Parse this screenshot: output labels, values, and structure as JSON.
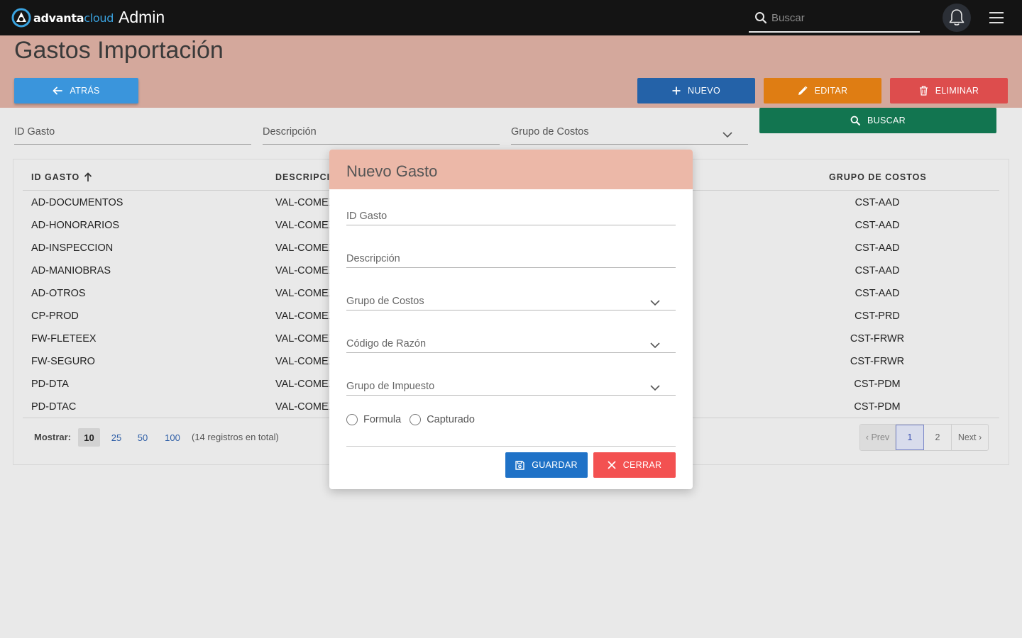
{
  "app": {
    "brand_part1": "advanta",
    "brand_part2": "cloud",
    "title": "Admin",
    "search_placeholder": "Buscar"
  },
  "page": {
    "title": "Gastos Importación",
    "back_label": "ATRÁS",
    "new_label": "NUEVO",
    "edit_label": "EDITAR",
    "delete_label": "ELIMINAR",
    "search_label": "BUSCAR"
  },
  "filters": {
    "id": "ID Gasto",
    "description": "Descripción",
    "cost_group": "Grupo de Costos"
  },
  "table": {
    "headers": [
      "ID GASTO",
      "DESCRIPCI",
      "GRUPO DE COSTOS"
    ],
    "rows": [
      {
        "id": "AD-DOCUMENTOS",
        "desc": "VAL-COMEX",
        "group": "CST-AAD"
      },
      {
        "id": "AD-HONORARIOS",
        "desc": "VAL-COMEX",
        "group": "CST-AAD"
      },
      {
        "id": "AD-INSPECCION",
        "desc": "VAL-COMEX",
        "group": "CST-AAD"
      },
      {
        "id": "AD-MANIOBRAS",
        "desc": "VAL-COMEX",
        "group": "CST-AAD"
      },
      {
        "id": "AD-OTROS",
        "desc": "VAL-COMEX",
        "group": "CST-AAD"
      },
      {
        "id": "CP-PROD",
        "desc": "VAL-COMEX",
        "group": "CST-PRD"
      },
      {
        "id": "FW-FLETEEX",
        "desc": "VAL-COMEX",
        "group": "CST-FRWR"
      },
      {
        "id": "FW-SEGURO",
        "desc": "VAL-COMEX",
        "group": "CST-FRWR"
      },
      {
        "id": "PD-DTA",
        "desc": "VAL-COMEX",
        "group": "CST-PDM"
      },
      {
        "id": "PD-DTAC",
        "desc": "VAL-COMEX",
        "group": "CST-PDM"
      }
    ]
  },
  "pagination": {
    "show_label": "Mostrar:",
    "sizes": [
      "10",
      "25",
      "50",
      "100"
    ],
    "total_text": "(14 registros en total)",
    "prev": "‹ Prev",
    "pages": [
      "1",
      "2"
    ],
    "next": "Next ›"
  },
  "modal": {
    "title": "Nuevo Gasto",
    "fields": {
      "id": "ID Gasto",
      "description": "Descripción",
      "cost_group": "Grupo de Costos",
      "reason_code": "Código de Razón",
      "tax_group": "Grupo de Impuesto"
    },
    "radio_formula": "Formula",
    "radio_captured": "Capturado",
    "save_label": "GUARDAR",
    "close_label": "CERRAR"
  },
  "colors": {
    "topbar": "#141414",
    "header_band": "#d4a89c",
    "btn_back": "#3a95dc",
    "btn_new": "#2462a8",
    "btn_edit": "#df7d13",
    "btn_delete": "#dd4d4d",
    "btn_search": "#127550",
    "modal_header": "#ecb8a8",
    "btn_save": "#1f72c7",
    "btn_close": "#f35151"
  }
}
